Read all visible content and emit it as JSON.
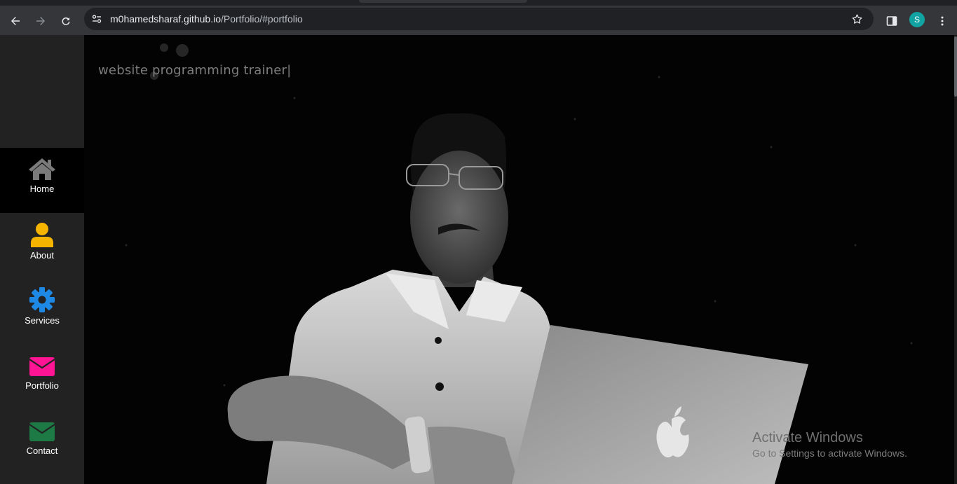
{
  "browser": {
    "url_host": "m0hamedsharaf.github.io",
    "url_path": "/Portfolio/#portfolio",
    "profile_initial": "S",
    "icons": {
      "back": "back-arrow-icon",
      "forward": "forward-arrow-icon",
      "reload": "reload-icon",
      "site_info": "site-info-icon",
      "bookmark": "star-icon",
      "side_panel": "side-panel-icon",
      "menu": "kebab-menu-icon"
    }
  },
  "sidebar": {
    "items": [
      {
        "label": "Home",
        "icon": "home-icon",
        "color": "#7a7a7a",
        "active": true
      },
      {
        "label": "About",
        "icon": "user-icon",
        "color": "#f5b400",
        "active": false
      },
      {
        "label": "Services",
        "icon": "gear-icon",
        "color": "#1e88e5",
        "active": false
      },
      {
        "label": "Portfolio",
        "icon": "envelope-icon",
        "color": "#ff1493",
        "active": false
      },
      {
        "label": "Contact",
        "icon": "envelope-icon",
        "color": "#1e7a45",
        "active": false
      }
    ]
  },
  "hero": {
    "typed_text": "website programming trainer|",
    "image": "portrait-photo"
  },
  "watermark": {
    "line1": "Activate Windows",
    "line2": "Go to Settings to activate Windows."
  },
  "colors": {
    "sidebar_bg": "#222222",
    "active_item_bg": "#000000",
    "page_bg": "#030303"
  }
}
